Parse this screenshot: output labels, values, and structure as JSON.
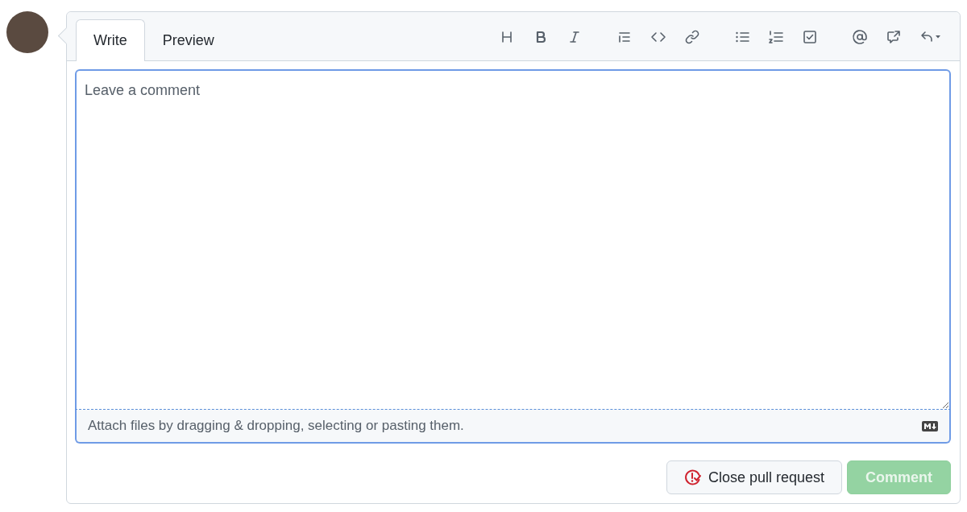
{
  "tabs": [
    {
      "label": "Write",
      "selected": true
    },
    {
      "label": "Preview",
      "selected": false
    }
  ],
  "editor": {
    "placeholder": "Leave a comment",
    "footer": "Attach files by dragging & dropping, selecting or pasting them."
  },
  "buttons": [
    {
      "kind": "close",
      "label": "Close pull request",
      "disabled": false
    },
    {
      "kind": "primary",
      "label": "Comment",
      "disabled": true
    }
  ]
}
